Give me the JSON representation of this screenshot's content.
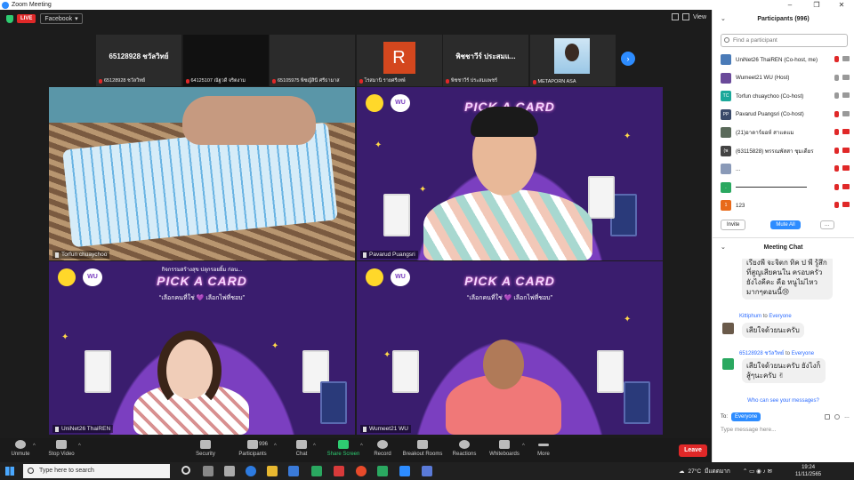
{
  "window": {
    "title": "Zoom Meeting",
    "minimize": "–",
    "maximize": "❐",
    "close": "✕"
  },
  "topbar": {
    "live": "LIVE",
    "stream_target": "Facebook",
    "view_label": "View"
  },
  "strip": [
    {
      "big_name": "65128928 ชวัลวิทย์",
      "label": "65128928 ชวัลวิทย์"
    },
    {
      "big_name": "",
      "label": "64125107 ณัฐวดี จริตงาม"
    },
    {
      "big_name": "",
      "label": "65105975 พิชญ์สินี ศรีธามาส"
    },
    {
      "big_name": "R",
      "label": "โรสมานิ รายศรีเทพ์"
    },
    {
      "big_name": "พิชชาวีร์ ประสมแ...",
      "label": "พิชชาวีร์ ประสมแพชร์"
    },
    {
      "big_name": "",
      "label": "METAPORN ASA"
    }
  ],
  "tiles": {
    "t1": "Torfun chuaychoo",
    "t2": "Pavarud Puangsri",
    "t3": "UniNet26 ThaiREN",
    "t4": "Wumeet21 WU"
  },
  "slide": {
    "brand": "WU",
    "header": "กิจกรรมสร้างสุข ปลุกรอยยิ้ม ก่อน...",
    "title": "PICK A CARD",
    "subtitle": "“เลือกคนที่ใช่ 💜 เลือกไพ่ที่ชอบ”"
  },
  "toolbar": {
    "unmute": "Unmute",
    "stop_video": "Stop Video",
    "security": "Security",
    "participants": "Participants",
    "participants_count": "996",
    "chat": "Chat",
    "share_screen": "Share Screen",
    "record": "Record",
    "breakout": "Breakout Rooms",
    "reactions": "Reactions",
    "whiteboards": "Whiteboards",
    "more": "More",
    "leave": "Leave"
  },
  "participants_panel": {
    "title": "Participants (996)",
    "search_placeholder": "Find a participant",
    "list": [
      {
        "name": "UniNet26 ThaiREN (Co-host, me)",
        "avatar": "",
        "color": "#4a7bb8"
      },
      {
        "name": "Wumeet21 WU (Host)",
        "avatar": "",
        "color": "#6a4a9a"
      },
      {
        "name": "Torfun chuaychoo (Co-host)",
        "avatar": "TC",
        "color": "#1aa89a"
      },
      {
        "name": "Pavarud Puangsri (Co-host)",
        "avatar": "PP",
        "color": "#3a4a6a"
      },
      {
        "name": "(21)อาดาร์ยอห์ สาแดแม",
        "avatar": "",
        "color": "#5a6a5a"
      },
      {
        "name": "(63115828) พรรณพัสสา ชุมเดียร",
        "avatar": "(พ",
        "color": "#444"
      },
      {
        "name": "...",
        "avatar": "",
        "color": "#8a9ab8"
      },
      {
        "name": "",
        "avatar": ".",
        "color": "#2aa860"
      },
      {
        "name": "123",
        "avatar": "1",
        "color": "#e86a1a"
      }
    ],
    "invite": "Invite",
    "mute_all": "Mute All",
    "more": "…"
  },
  "chat": {
    "title": "Meeting Chat",
    "messages": [
      {
        "sender": "",
        "to": "",
        "text": "เรียงพี่ จะจิตก ทิค ป พี รู้สึกที่สูญเสียคนใน ครอบครัวยังไงคีคะ คือ หนูไม่ไหวมากๆตอนนี้😢"
      },
      {
        "sender": "Kittiphum",
        "to": "Everyone",
        "text": "เสียใจด้วยนะครับ"
      },
      {
        "sender": "65128928 ชวัลวิทย์",
        "to": "Everyone",
        "text": "เสียใจด้วยนะครับ ยังไงก็ สู้ๆนะครับ ✌"
      }
    ],
    "to_word": "to",
    "who_can_see": "Who can see your messages?",
    "to_label": "To:",
    "recipient": "Everyone",
    "input_placeholder": "Type message here..."
  },
  "taskbar": {
    "search_placeholder": "Type here to search",
    "temperature": "27°C",
    "weather": "มีแดดมาก",
    "time": "19:24",
    "date": "11/11/2565"
  }
}
